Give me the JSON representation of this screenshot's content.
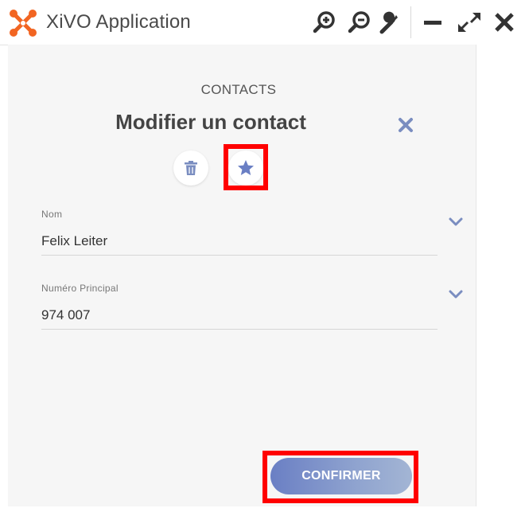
{
  "app": {
    "title": "XiVO Application",
    "logo_icon": "xivo-logo-icon",
    "brand_color": "#f26522"
  },
  "titlebar": {
    "buttons": [
      {
        "name": "zoom-in",
        "icon": "zoom-in-icon"
      },
      {
        "name": "zoom-out",
        "icon": "zoom-out-icon"
      },
      {
        "name": "settings",
        "icon": "wrench-icon"
      },
      {
        "name": "minimize",
        "icon": "minimize-icon"
      },
      {
        "name": "expand",
        "icon": "expand-icon"
      },
      {
        "name": "close",
        "icon": "close-icon"
      }
    ]
  },
  "panel": {
    "section": "CONTACTS",
    "title": "Modifier un contact",
    "close_icon": "close-icon",
    "actions": [
      {
        "name": "delete",
        "icon": "trash-icon"
      },
      {
        "name": "favorite",
        "icon": "star-icon",
        "highlighted": true
      }
    ]
  },
  "form": {
    "fields": [
      {
        "label": "Nom",
        "value": "Felix Leiter"
      },
      {
        "label": "Numéro Principal",
        "value": "974 007"
      }
    ],
    "confirm_label": "CONFIRMER"
  },
  "colors": {
    "accent": "#6a7fc4",
    "icon_blue": "#7a8dc0",
    "highlight": "#ff0000",
    "text_dark": "#444444"
  }
}
